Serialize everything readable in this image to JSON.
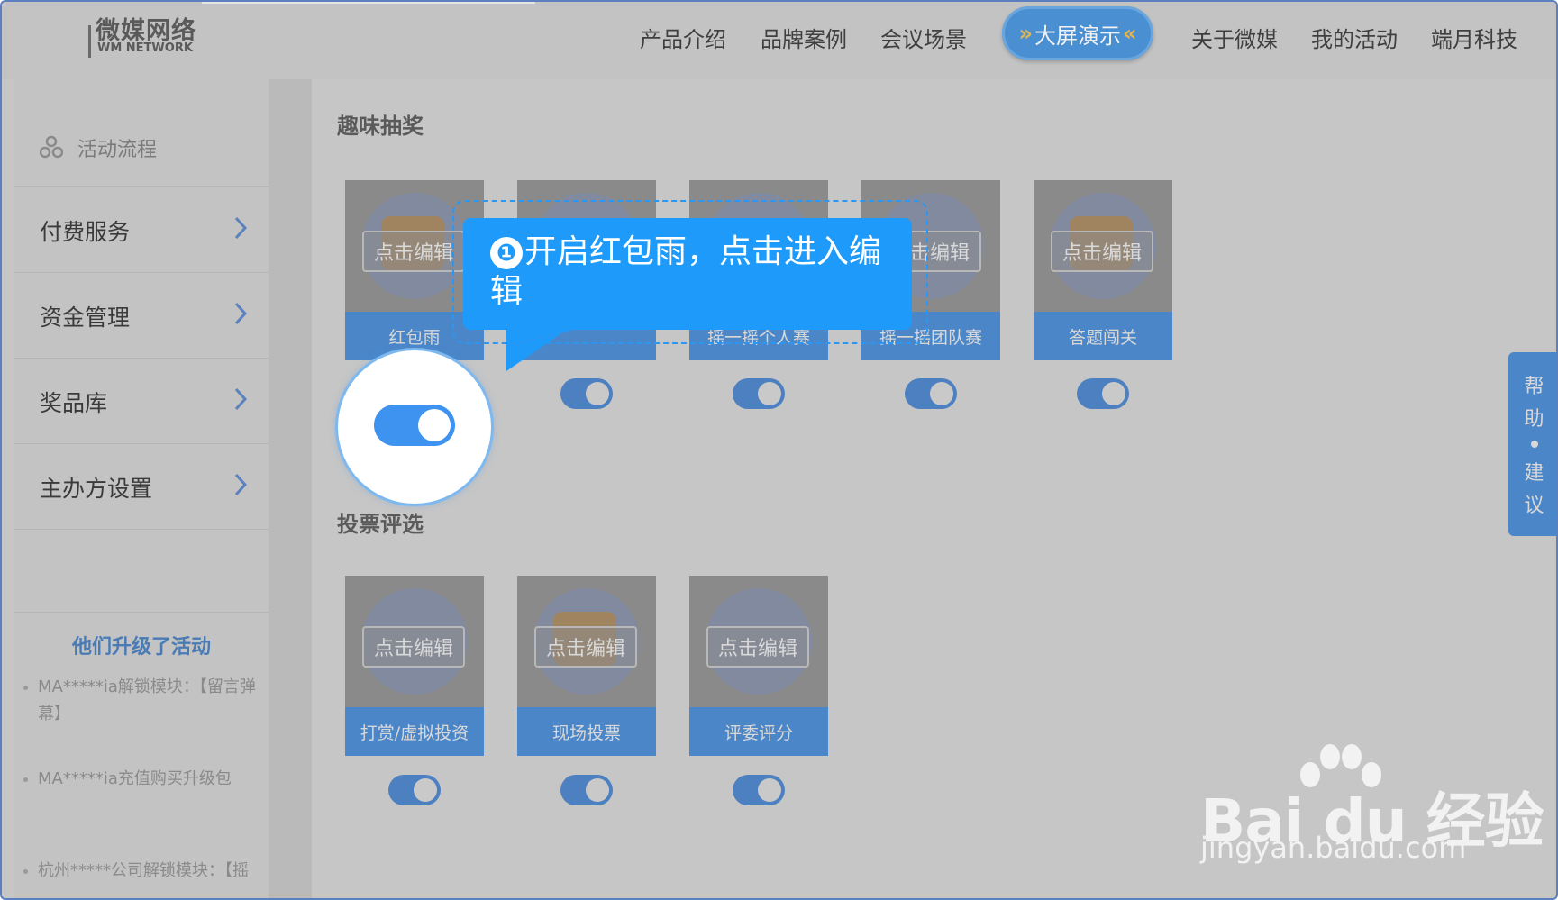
{
  "header": {
    "logo_cn": "微媒网络",
    "logo_en": "WM NETWORK",
    "nav": [
      "产品介绍",
      "品牌案例",
      "会议场景",
      "关于微媒",
      "我的活动",
      "端月科技"
    ],
    "active_nav": "大屏演示"
  },
  "sidebar": {
    "top_item": "活动流程",
    "items": [
      "付费服务",
      "资金管理",
      "奖品库",
      "主办方设置"
    ],
    "promo_title": "他们升级了活动",
    "promos": [
      "MA*****ia解锁模块：【留言弹幕】",
      "MA*****ia充值购买升级包",
      "杭州*****公司解锁模块：【摇"
    ]
  },
  "main": {
    "section1_title": "趣味抽奖",
    "section1_cards": [
      "红包雨",
      "",
      "摇一摇个人赛",
      "摇一摇团队赛",
      "答题闯关"
    ],
    "section2_title": "投票评选",
    "section2_cards": [
      "打赏/虚拟投资",
      "现场投票",
      "评委评分"
    ],
    "edit_label": "点击编辑"
  },
  "callout": {
    "step": "❶",
    "text": "开启红包雨，点击进入编辑"
  },
  "help_tab": {
    "chars": [
      "帮",
      "助",
      "建",
      "议"
    ]
  },
  "watermark": {
    "brand": "Bai du 经验",
    "url": "jingyan.baidu.com"
  },
  "colors": {
    "accent_blue": "#1e9bfa",
    "toggle_on": "#3f93f0",
    "card_footer": "#4a86c8"
  }
}
